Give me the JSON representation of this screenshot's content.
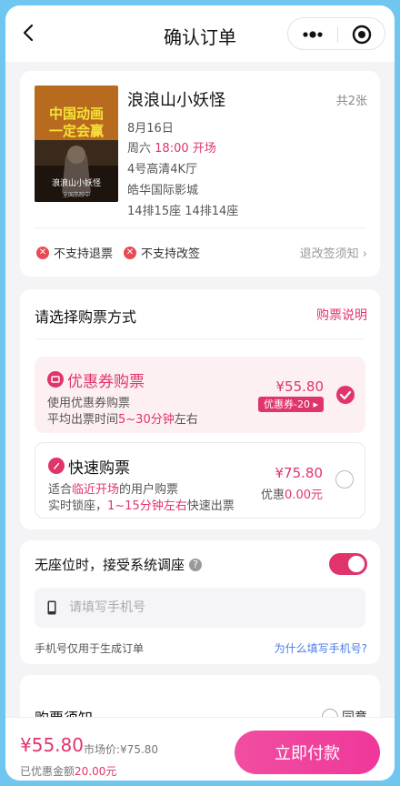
{
  "header": {
    "title": "确认订单"
  },
  "movie": {
    "poster_text_1": "中国动画",
    "poster_text_2": "一定会赢",
    "poster_sub": "浪浪山小妖怪",
    "poster_caption": "全国热映中",
    "title": "浪浪山小妖怪",
    "count": "共2张",
    "date": "8月16日",
    "weekday": "周六",
    "time": "18:00 开场",
    "hall": "4号高清4K厅",
    "cinema": "皓华国际影城",
    "seats": "14排15座 14排14座",
    "no_refund": "不支持退票",
    "no_change": "不支持改签",
    "policy_link": "退改签须知"
  },
  "purchase": {
    "title": "请选择购票方式",
    "help_link": "购票说明",
    "options": [
      {
        "name": "优惠券购票",
        "line1": "使用优惠券购票",
        "line2_pre": "平均出票时间",
        "line2_hl": "5~30分钟",
        "line2_post": "左右",
        "price": "¥55.80",
        "badge": "优惠券-20 ▸",
        "selected": true
      },
      {
        "name": "快速购票",
        "line1_pre": "适合",
        "line1_hl": "临近开场",
        "line1_post": "的用户购票",
        "line2_pre": "实时锁座，",
        "line2_hl": "1~15分钟左右",
        "line2_post": "快速出票",
        "price": "¥75.80",
        "discount_label": "优惠",
        "discount_value": "0.00元",
        "selected": false
      }
    ]
  },
  "seat_adjust": {
    "label": "无座位时，接受系统调座",
    "help": "?",
    "enabled": true,
    "phone_placeholder": "请填写手机号",
    "note": "手机号仅用于生成订单",
    "why_link": "为什么填写手机号?"
  },
  "notice": {
    "title": "购票须知",
    "agree": "同意"
  },
  "footer": {
    "total": "¥55.80",
    "market_price": "市场价:¥75.80",
    "saved_label": "已优惠金额",
    "saved_value": "20.00元",
    "pay_button": "立即付款"
  },
  "colors": {
    "accent": "#e0356b",
    "link": "#4a7de8"
  }
}
